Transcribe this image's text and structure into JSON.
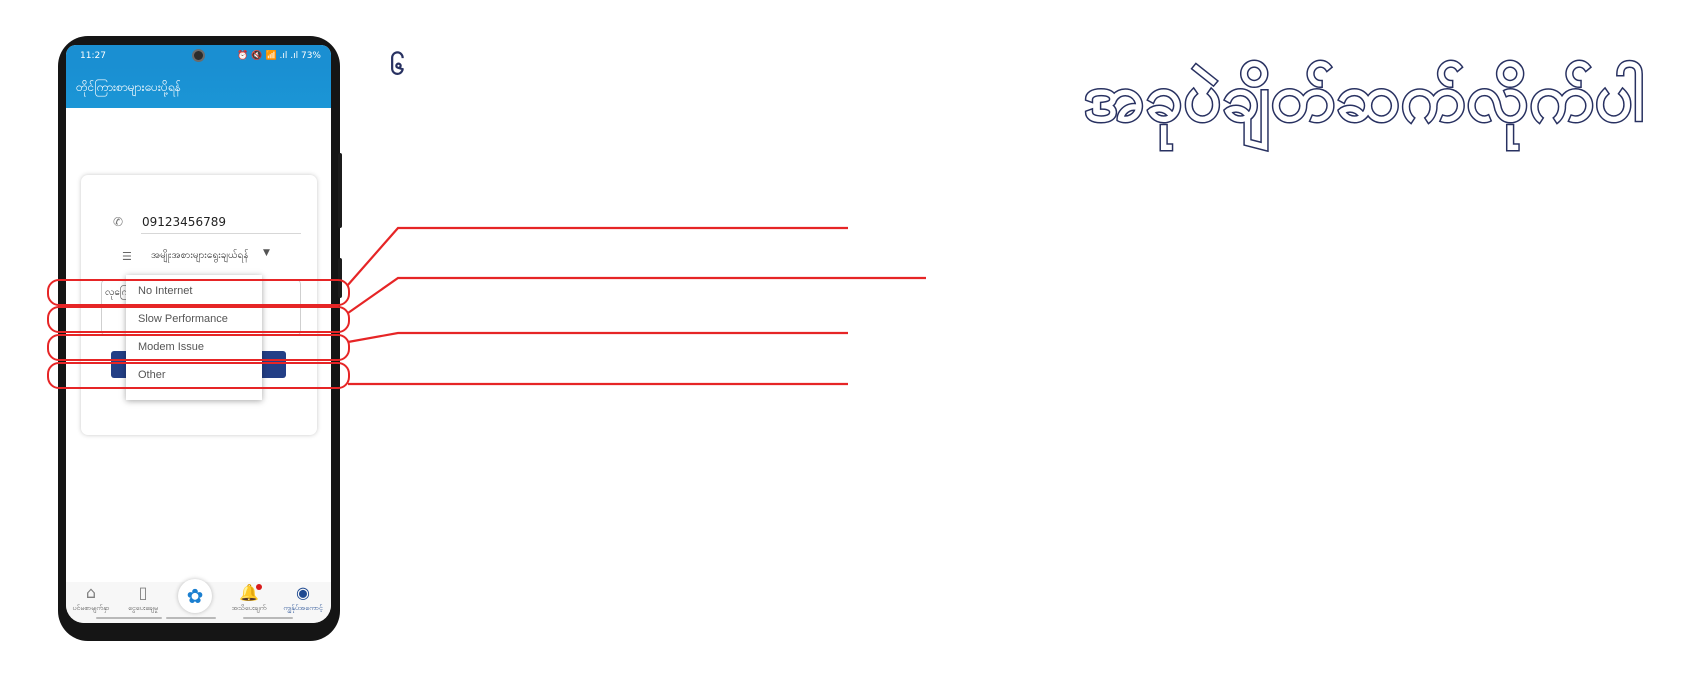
{
  "statusbar": {
    "time": "11:27",
    "icons": "⏰ 🔇 📶 .ıl .ıl",
    "battery": "73%"
  },
  "appbar": {
    "title": "တိုင်ကြားစာများပေးပို့ရန်"
  },
  "form": {
    "phone_value": "09123456789",
    "select_label": "အမျိုးအစားများရွေးချယ်ရန်",
    "input_label": "လုကြေး"
  },
  "dropdown": {
    "options": [
      "No Internet",
      "Slow Performance",
      "Modem Issue",
      "Other"
    ]
  },
  "bottom_nav": {
    "items": [
      {
        "label": "ပင်မစာမျက်နှာ",
        "icon": "home-icon"
      },
      {
        "label": "ငွေပေးချေမှု",
        "icon": "payment-icon"
      },
      {
        "label": "",
        "icon": "logo-icon"
      },
      {
        "label": "အသိပေးချက်",
        "icon": "bell-icon"
      },
      {
        "label": "ကျွန်ုပ်အကောင့်",
        "icon": "account-icon"
      }
    ]
  },
  "annotation": {
    "step_number": "၆",
    "headline": "အခုပဲချိတ်ဆက်လိုက်ပါ",
    "highlight_color": "#e62526",
    "text_color": "#283161"
  },
  "colors": {
    "appbar": "#1a8fd2",
    "button": "#233f86",
    "accent": "#e62526"
  }
}
